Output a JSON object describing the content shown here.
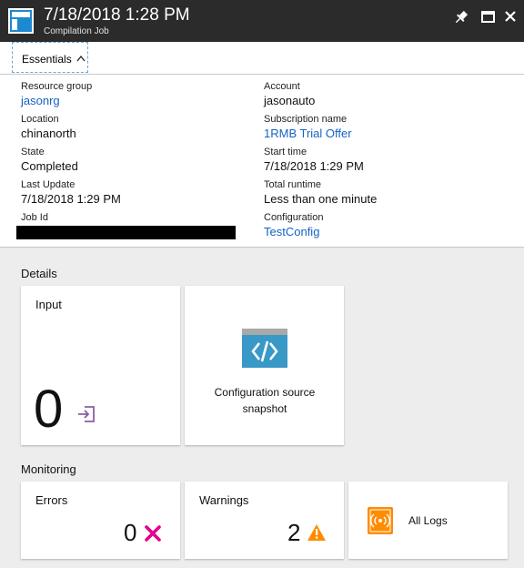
{
  "header": {
    "title": "7/18/2018 1:28 PM",
    "subtitle": "Compilation Job",
    "icons": [
      "compilation-job-icon",
      "pin-icon",
      "maximize-icon",
      "close-icon"
    ]
  },
  "essentials": {
    "label": "Essentials"
  },
  "properties": {
    "resource_group": {
      "label": "Resource group",
      "value": "jasonrg"
    },
    "location": {
      "label": "Location",
      "value": "chinanorth"
    },
    "state": {
      "label": "State",
      "value": "Completed"
    },
    "last_update": {
      "label": "Last Update",
      "value": "7/18/2018 1:29 PM"
    },
    "job_id": {
      "label": "Job Id"
    },
    "account": {
      "label": "Account",
      "value": "jasonauto"
    },
    "subscription_name": {
      "label": "Subscription name",
      "value": "1RMB Trial Offer"
    },
    "start_time": {
      "label": "Start time",
      "value": "7/18/2018 1:29 PM"
    },
    "total_runtime": {
      "label": "Total runtime",
      "value": "Less than one minute"
    },
    "configuration": {
      "label": "Configuration",
      "value": "TestConfig"
    }
  },
  "details": {
    "title": "Details",
    "input": {
      "title": "Input",
      "count": "0"
    },
    "config_source": {
      "label_line1": "Configuration source",
      "label_line2": "snapshot"
    }
  },
  "monitoring": {
    "title": "Monitoring",
    "errors": {
      "title": "Errors",
      "count": "0"
    },
    "warnings": {
      "title": "Warnings",
      "count": "2"
    },
    "all_logs": {
      "label": "All Logs"
    }
  },
  "colors": {
    "header_bg": "#2b2b2b",
    "link": "#1563c4",
    "error": "#e3008c",
    "warning": "#ff8c00",
    "logs": "#ff8c00",
    "config_icon": "#3999c6",
    "input_icon": "#8a5da5"
  }
}
